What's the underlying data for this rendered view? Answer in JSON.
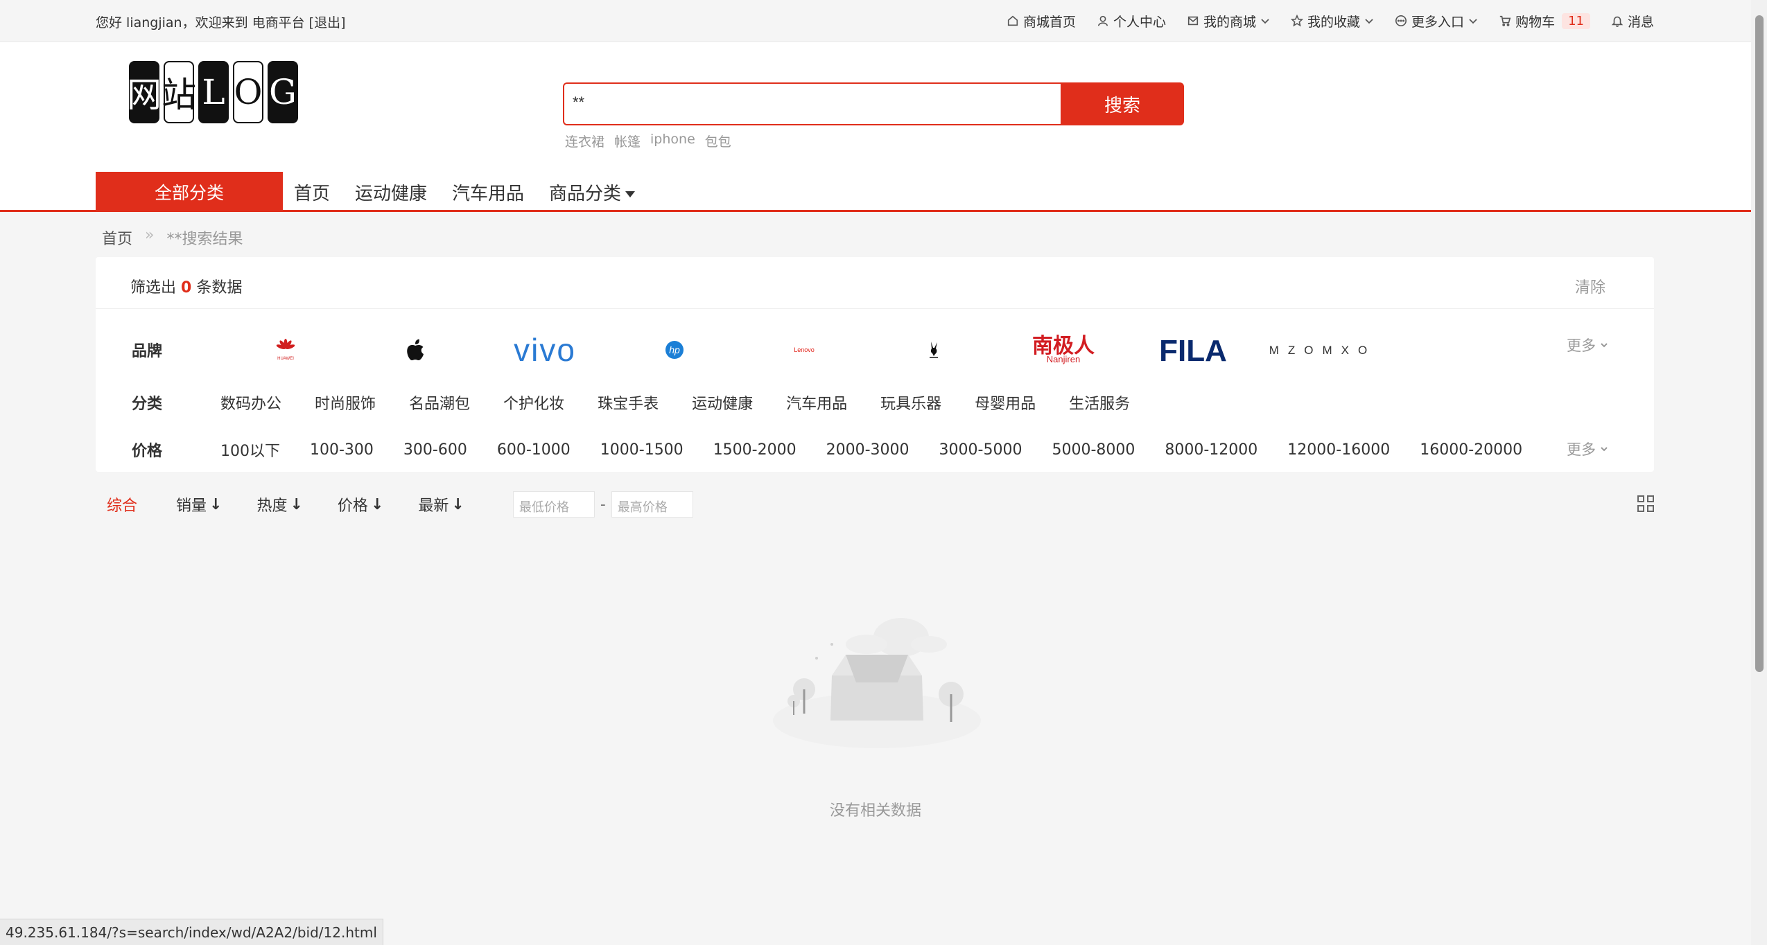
{
  "topbar": {
    "greeting": "您好 liangjian，欢迎来到 电商平台 [退出]",
    "nav": {
      "home": "商城首页",
      "user_center": "个人中心",
      "my_mall": "我的商城",
      "favorites": "我的收藏",
      "more_entry": "更多入口",
      "cart": "购物车",
      "cart_count": "11",
      "messages": "消息"
    }
  },
  "header": {
    "logo_chars": [
      "网",
      "站",
      "L",
      "O",
      "G"
    ],
    "search": {
      "value": "**",
      "button": "搜索"
    },
    "hot_words": [
      "连衣裙",
      "帐篷",
      "iphone",
      "包包"
    ],
    "all_categories": "全部分类",
    "nav_links": [
      "首页",
      "运动健康",
      "汽车用品"
    ],
    "nav_dropdown": "商品分类"
  },
  "breadcrumb": {
    "home": "首页",
    "sep": "»",
    "current": "**搜索结果"
  },
  "filter": {
    "count_prefix": "筛选出",
    "count": "0",
    "count_suffix": "条数据",
    "clear": "清除",
    "brand_label": "品牌",
    "brands": {
      "huawei_text": "HUAWEI",
      "vivo_text": "vivo",
      "hp_text": "hp",
      "lenovo_text": "Lenovo",
      "nanjiren_text": "南极人",
      "nanjiren_sub": "Nanjiren",
      "fila_text": "FILA",
      "mzomxo_text": "MZOMXO"
    },
    "category_label": "分类",
    "categories": [
      "数码办公",
      "时尚服饰",
      "名品潮包",
      "个护化妆",
      "珠宝手表",
      "运动健康",
      "汽车用品",
      "玩具乐器",
      "母婴用品",
      "生活服务"
    ],
    "price_label": "价格",
    "prices": [
      "100以下",
      "100-300",
      "300-600",
      "600-1000",
      "1000-1500",
      "1500-2000",
      "2000-3000",
      "3000-5000",
      "5000-8000",
      "8000-12000",
      "12000-16000",
      "16000-20000"
    ],
    "more": "更多"
  },
  "sort": {
    "items": [
      "综合",
      "销量",
      "热度",
      "价格",
      "最新"
    ],
    "min_price_placeholder": "最低价格",
    "max_price_placeholder": "最高价格",
    "dash": "-"
  },
  "empty": {
    "text": "没有相关数据"
  },
  "status_url": "49.235.61.184/?s=search/index/wd/A2A2/bid/12.html",
  "colors": {
    "accent": "#e02e1b",
    "fila_navy": "#0a2a6e",
    "vivo_blue": "#2a7ad3"
  }
}
